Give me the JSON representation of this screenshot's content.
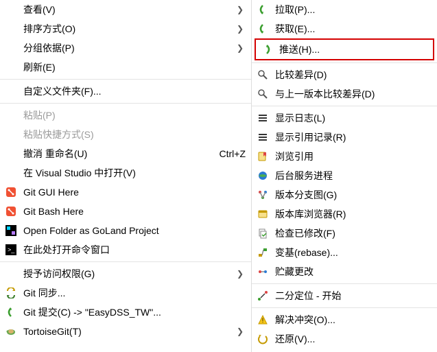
{
  "left": {
    "view": "查看(V)",
    "sort": "排序方式(O)",
    "group": "分组依据(P)",
    "refresh": "刷新(E)",
    "custom_folder": "自定义文件夹(F)...",
    "paste": "粘贴(P)",
    "paste_shortcut": "粘贴快捷方式(S)",
    "undo_rename": "撤消 重命名(U)",
    "undo_shortcut": "Ctrl+Z",
    "open_vs": "在 Visual Studio 中打开(V)",
    "git_gui": "Git GUI Here",
    "git_bash": "Git Bash Here",
    "open_goland": "Open Folder as GoLand Project",
    "open_cmd": "在此处打开命令窗口",
    "grant_access": "授予访问权限(G)",
    "git_sync": "Git 同步...",
    "git_commit": "Git 提交(C) -> \"EasyDSS_TW\"...",
    "tortoise": "TortoiseGit(T)"
  },
  "right": {
    "pull": "拉取(P)...",
    "fetch": "获取(E)...",
    "push": "推送(H)...",
    "diff": "比较差异(D)",
    "diff_prev": "与上一版本比较差异(D)",
    "show_log": "显示日志(L)",
    "show_reflog": "显示引用记录(R)",
    "browse_refs": "浏览引用",
    "daemon": "后台服务进程",
    "branch_graph": "版本分支图(G)",
    "repo_browser": "版本库浏览器(R)",
    "check_mod": "检查已修改(F)",
    "rebase": "变基(rebase)...",
    "stash": "贮藏更改",
    "bisect": "二分定位 - 开始",
    "resolve": "解决冲突(O)...",
    "revert": "还原(V)..."
  }
}
